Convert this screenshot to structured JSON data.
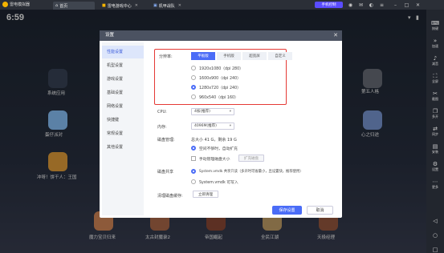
{
  "titlebar": {
    "app_name": "雷电模拟器",
    "tabs": [
      {
        "label": "首页"
      },
      {
        "label": "雷电游戏中心"
      },
      {
        "label": "机甲战队"
      }
    ],
    "phone_control_label": "手机控制"
  },
  "desktop": {
    "time": "6:59",
    "apps_left": [
      {
        "label": "系统应用"
      },
      {
        "label": "蛋仔派对"
      },
      {
        "label": "冲呀！饼干人：王国"
      }
    ],
    "apps_right": [
      {
        "label": "第五人格"
      },
      {
        "label": "心之归途"
      }
    ],
    "dock": [
      {
        "label": "魔力宝贝归来"
      },
      {
        "label": "太古封魔录2"
      },
      {
        "label": "帝国崛起"
      },
      {
        "label": "全民江湖"
      },
      {
        "label": "天极经理"
      }
    ]
  },
  "sidebar": {
    "items": [
      {
        "label": "按键"
      },
      {
        "label": "加速"
      },
      {
        "label": "减音"
      },
      {
        "label": "全屏"
      },
      {
        "label": "截图"
      },
      {
        "label": "多开"
      },
      {
        "label": "同步"
      },
      {
        "label": "安装"
      },
      {
        "label": "设置"
      },
      {
        "label": "更多"
      }
    ]
  },
  "dialog": {
    "title": "设置",
    "nav": [
      {
        "label": "性能设置"
      },
      {
        "label": "机型设置"
      },
      {
        "label": "游戏设置"
      },
      {
        "label": "基础设置"
      },
      {
        "label": "网络设置"
      },
      {
        "label": "快捷键"
      },
      {
        "label": "常规设置"
      },
      {
        "label": "其他设置"
      }
    ],
    "resolution": {
      "label": "分辨率:",
      "segments": [
        {
          "label": "平板版"
        },
        {
          "label": "手机版"
        },
        {
          "label": "超宽屏"
        },
        {
          "label": "自定义"
        }
      ],
      "options": [
        {
          "label": "1920x1080（dpi 280）"
        },
        {
          "label": "1600x900（dpi 240）"
        },
        {
          "label": "1280x720（dpi 240）"
        },
        {
          "label": "960x540（dpi 160）"
        }
      ],
      "selected_index": 2
    },
    "cpu": {
      "label": "CPU:",
      "value": "4核(推荐)"
    },
    "memory": {
      "label": "内存:",
      "value": "4096M(推荐)"
    },
    "disk": {
      "label": "磁盘管理:",
      "info": "总大小 41 G，剩余 19 G",
      "opt_auto": "空间不够时，自动扩充",
      "opt_manual": "手动管理磁盘大小",
      "expand_button": "扩充磁盘"
    },
    "disk_share": {
      "label": "磁盘共享",
      "opt_readonly": "System.vmdk 共享只读（多开时可省最小，且设置快，推荐使用）",
      "opt_writable": "System.vmdk 可写入"
    },
    "clean": {
      "label": "清理磁盘缓存:",
      "button": "立即清理"
    },
    "save_button": "保存设置",
    "cancel_button": "取消"
  },
  "colors": {
    "accent": "#4a6cf7",
    "highlight_border": "#e53935"
  }
}
